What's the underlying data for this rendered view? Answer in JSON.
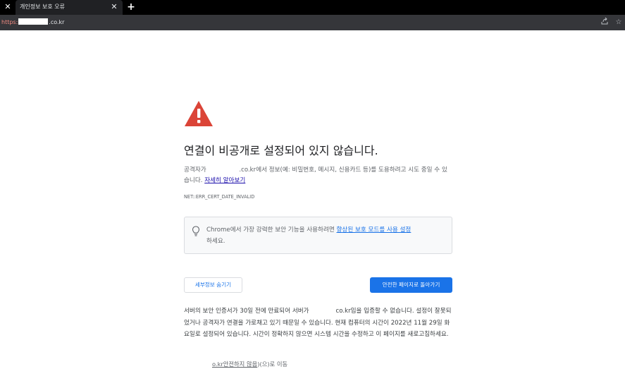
{
  "tab": {
    "title": "개인정보 보호 오류"
  },
  "address_bar": {
    "scheme": "https:",
    "host": ".co.kr"
  },
  "icons": {
    "tab_close": "close-icon",
    "new_tab": "plus-icon",
    "share": "share-icon",
    "bookmark": "star-icon",
    "warning": "warning-triangle-icon",
    "bulb": "lightbulb-icon"
  },
  "colors": {
    "warning": "#db4437",
    "primary_button": "#1a73e8",
    "link": "#1a0dab"
  },
  "interstitial": {
    "heading": "연결이 비공개로 설정되어 있지 않습니다.",
    "desc_prefix": "공격자가",
    "desc_host": ".co.kr",
    "desc_text": "에서 정보(예: 비밀번호, 메시지, 신용카드 등)를 도용하려고 시도 중일 수 있습니다.",
    "learn_more": "자세히 알아보기",
    "error_code": "NET::ERR_CERT_DATE_INVALID",
    "promo_text_before": "Chrome에서 가장 강력한 보안 기능을 사용하려면",
    "promo_link": "향상된 보호 모드를 사용 설정",
    "promo_text_after": "하세요.",
    "hide_details_button": "세부정보 숨기기",
    "back_to_safety_button": "안전한 페이지로 돌아가기",
    "details_prefix": "서버의 보안 인증서가 30일 전에 만료되어 서버가",
    "details_host": "co.kr",
    "details_text": "임을 입증할 수 없습니다. 설정이 잘못되었거나 공격자가 연결을 가로채고 있기 때문일 수 있습니다. 현재 컴퓨터의 시간이 2022년 11월 29일 화요일로 설정되어 있습니다. 시간이 정확하지 않으면 시스템 시간을 수정하고 이 페이지를 새로고침하세요.",
    "proceed_link": "o.kr안전하지 않음",
    "proceed_suffix": ")(으)로 이동"
  }
}
